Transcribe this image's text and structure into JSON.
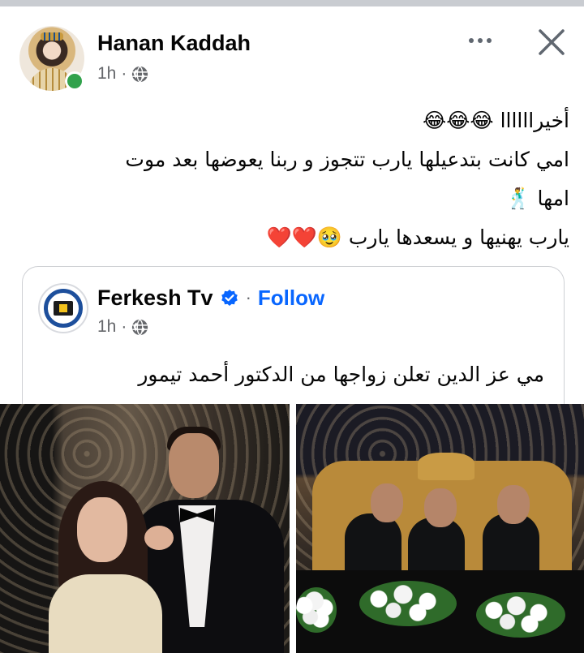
{
  "post": {
    "author": "Hanan Kaddah",
    "time": "1h",
    "separator": "·",
    "privacy_icon": "globe-icon",
    "more_icon": "more-options-icon",
    "close_icon": "close-icon",
    "text_lines": [
      "أخيراااااا 😂😂😂",
      "امي كانت بتدعيلها يارب تتجوز و ربنا يعوضها بعد موت",
      "امها 🕺",
      "يارب يهنيها و يسعدها يارب 🥹❤️❤️"
    ]
  },
  "shared": {
    "page_name": "Ferkesh Tv",
    "verified_icon": "verified-badge-icon",
    "separator": "·",
    "follow_label": "Follow",
    "time": "1h",
    "privacy_icon": "globe-icon",
    "text": "مي عز الدين تعلن زواجها من الدكتور أحمد تيمور"
  },
  "colors": {
    "accent": "#0866ff",
    "online": "#31a24c",
    "secondary_text": "#65676b"
  }
}
